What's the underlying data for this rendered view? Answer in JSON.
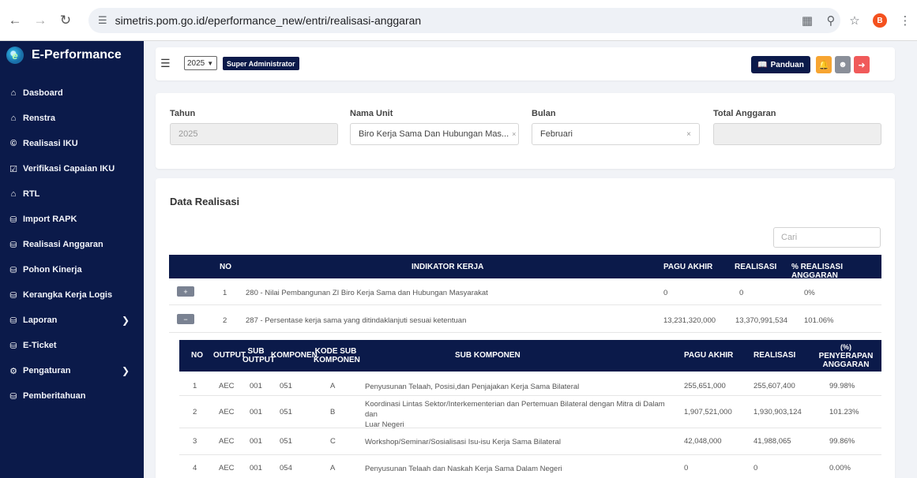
{
  "browser": {
    "url": "simetris.pom.go.id/eperformance_new/entri/realisasi-anggaran",
    "profile_initial": "B"
  },
  "sidebar": {
    "brand": "E-Performance",
    "items": [
      {
        "label": "Dasboard",
        "icon": "home-icon"
      },
      {
        "label": "Renstra",
        "icon": "home-icon"
      },
      {
        "label": "Realisasi IKU",
        "icon": "copyright-icon"
      },
      {
        "label": "Verifikasi Capaian IKU",
        "icon": "checkbox-icon"
      },
      {
        "label": "RTL",
        "icon": "home-icon"
      },
      {
        "label": "Import RAPK",
        "icon": "database-icon"
      },
      {
        "label": "Realisasi Anggaran",
        "icon": "database-icon"
      },
      {
        "label": "Pohon Kinerja",
        "icon": "database-icon"
      },
      {
        "label": "Kerangka Kerja Logis",
        "icon": "database-icon"
      },
      {
        "label": "Laporan",
        "icon": "database-icon",
        "has_children": true
      },
      {
        "label": "E-Ticket",
        "icon": "database-icon"
      },
      {
        "label": "Pengaturan",
        "icon": "gear-icon",
        "has_children": true
      },
      {
        "label": "Pemberitahuan",
        "icon": "database-icon"
      }
    ]
  },
  "header": {
    "year": "2025",
    "role": "Super Administrator",
    "panduan_label": "Panduan"
  },
  "filter": {
    "tahun_label": "Tahun",
    "tahun_value": "2025",
    "unit_label": "Nama Unit",
    "unit_value": "Biro Kerja Sama Dan Hubungan Mas...",
    "bulan_label": "Bulan",
    "bulan_value": "Februari",
    "total_label": "Total Anggaran",
    "total_value": ""
  },
  "data": {
    "title": "Data Realisasi",
    "search_placeholder": "Cari",
    "columns": {
      "no": "NO",
      "indikator": "INDIKATOR KERJA",
      "pagu": "PAGU AKHIR",
      "realisasi": "REALISASI",
      "persen": "% REALISASI ANGGARAN"
    },
    "rows": [
      {
        "btn": "+",
        "no": "1",
        "indikator": "280 - Nilai Pembangunan ZI Biro Kerja Sama dan Hubungan Masyarakat",
        "pagu": "0",
        "realisasi": "0",
        "persen": "0%"
      },
      {
        "btn": "−",
        "no": "2",
        "indikator": "287 - Persentase kerja sama yang ditindaklanjuti sesuai ketentuan",
        "pagu": "13,231,320,000",
        "realisasi": "13,370,991,534",
        "persen": "101.06%"
      }
    ],
    "sub_columns": {
      "no": "NO",
      "output": "OUTPUT",
      "sub_output_1": "SUB",
      "sub_output_2": "OUTPUT",
      "komponen": "KOMPONEN",
      "kode_1": "KODE SUB",
      "kode_2": "KOMPONEN",
      "sub_komponen": "SUB KOMPONEN",
      "pagu": "PAGU AKHIR",
      "realisasi": "REALISASI",
      "persen_1": "(%)",
      "persen_2": "PENYERAPAN",
      "persen_3": "ANGGARAN"
    },
    "sub_rows": [
      {
        "no": "1",
        "output": "AEC",
        "sub_output": "001",
        "komponen": "051",
        "kode": "A",
        "sub_komponen_1": "Penyusunan Telaah, Posisi,dan Penjajakan Kerja Sama Bilateral",
        "sub_komponen_2": "",
        "pagu": "255,651,000",
        "realisasi": "255,607,400",
        "persen": "99.98%"
      },
      {
        "no": "2",
        "output": "AEC",
        "sub_output": "001",
        "komponen": "051",
        "kode": "B",
        "sub_komponen_1": "Koordinasi Lintas Sektor/Interkementerian dan Pertemuan Bilateral dengan Mitra di Dalam dan",
        "sub_komponen_2": "Luar Negeri",
        "pagu": "1,907,521,000",
        "realisasi": "1,930,903,124",
        "persen": "101.23%"
      },
      {
        "no": "3",
        "output": "AEC",
        "sub_output": "001",
        "komponen": "051",
        "kode": "C",
        "sub_komponen_1": "Workshop/Seminar/Sosialisasi Isu-isu Kerja Sama Bilateral",
        "sub_komponen_2": "",
        "pagu": "42,048,000",
        "realisasi": "41,988,065",
        "persen": "99.86%"
      },
      {
        "no": "4",
        "output": "AEC",
        "sub_output": "001",
        "komponen": "054",
        "kode": "A",
        "sub_komponen_1": "Penyusunan Telaah dan Naskah Kerja Sama Dalam Negeri",
        "sub_komponen_2": "",
        "pagu": "0",
        "realisasi": "0",
        "persen": "0.00%"
      }
    ]
  }
}
